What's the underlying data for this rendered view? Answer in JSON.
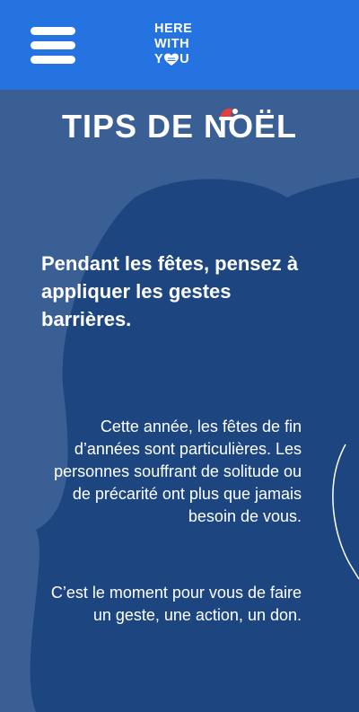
{
  "header": {
    "logo_line1": "HERE",
    "logo_line2": "WITH",
    "logo_line3_start": "Y",
    "logo_line3_end": "U"
  },
  "colors": {
    "header_bg": "#2473e0",
    "light_panel": "#3a5f94",
    "dark_panel": "#1d4680",
    "hat_red": "#e0423a"
  },
  "icons": {
    "menu": "hamburger-icon",
    "logo_heart": "heart-icon",
    "decoration": "santa-hat-icon"
  },
  "main": {
    "title": "TIPS DE NOËL",
    "subtitle": "Pendant les fêtes, pensez à appliquer les gestes barrières.",
    "paragraph1": "Cette année, les fêtes de fin d’années sont particulières. Les personnes souffrant de solitude ou de précarité ont plus que jamais besoin de vous.",
    "paragraph2": "C’est le moment pour vous de faire un geste, une action, un don."
  }
}
